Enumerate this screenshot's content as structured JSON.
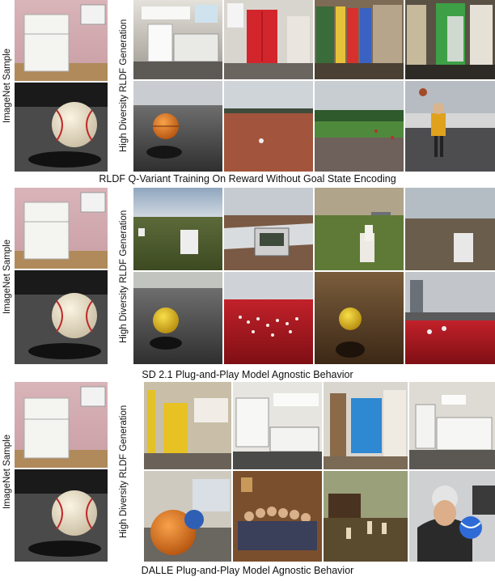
{
  "panels": [
    {
      "left_label": "ImageNet  Sample",
      "right_label": "High Diversity  RLDF  Generation",
      "caption": "RLDF  Q-Variant  Training  On  Reward  Without  Goal State  Encoding"
    },
    {
      "left_label": "ImageNet  Sample",
      "right_label": "High Diversity  RLDF  Generation",
      "caption": "SD 2.1 Plug-and-Play  Model  Agnostic Behavior"
    },
    {
      "left_label": "ImageNet  Sample",
      "right_label": "High Diversity  RLDF  Generation",
      "caption": "DALLE  Plug-and-Play  Model  Agnostic Behavior"
    }
  ]
}
